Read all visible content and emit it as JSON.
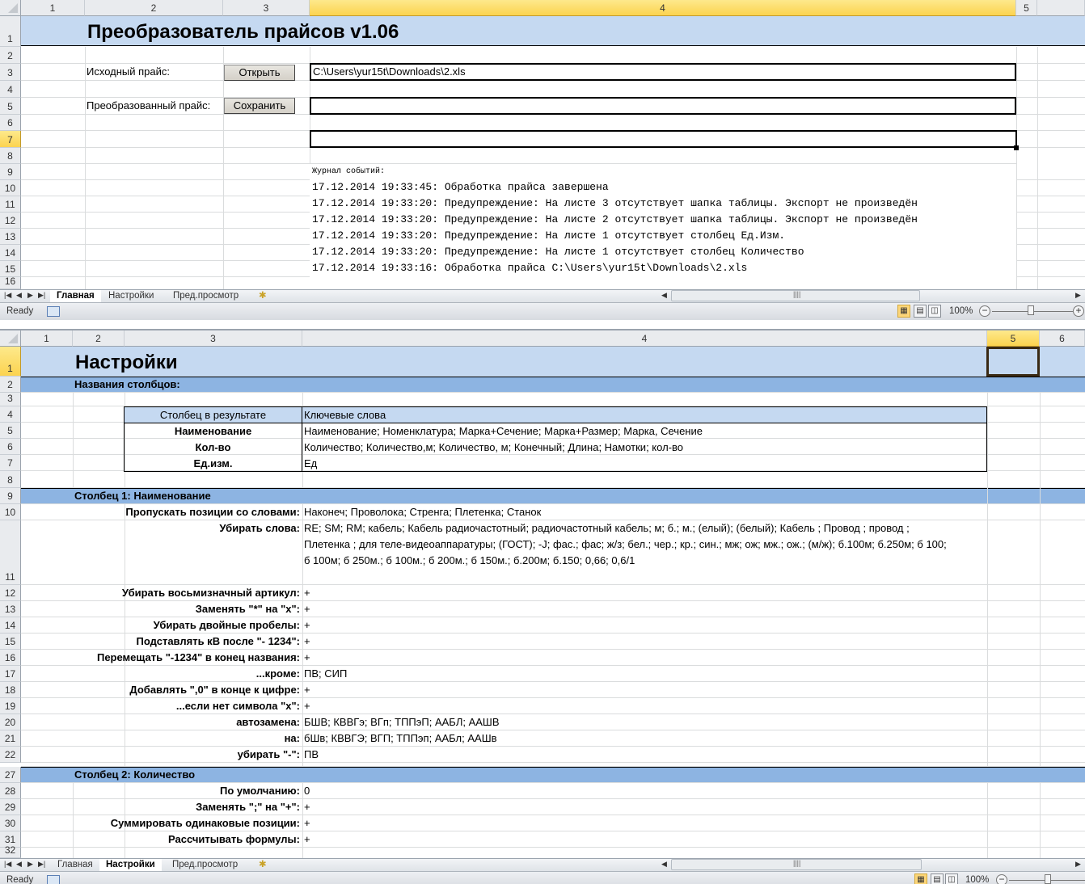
{
  "window1": {
    "col_headers": [
      "1",
      "2",
      "3",
      "4",
      "5"
    ],
    "row_headers": [
      "1",
      "2",
      "3",
      "4",
      "5",
      "6",
      "7",
      "8",
      "9",
      "10",
      "11",
      "12",
      "13",
      "14",
      "15",
      "16"
    ],
    "title": "Преобразователь прайсов v1.06",
    "source_label": "Исходный прайс:",
    "open_button": "Открыть",
    "source_path": "C:\\Users\\yur15t\\Downloads\\2.xls",
    "converted_label": "Преобразованный прайс:",
    "save_button": "Сохранить",
    "output_path": "",
    "extra_field": "",
    "log_title": "Журнал событий:",
    "log": [
      "17.12.2014 19:33:45: Обработка прайса завершена",
      "17.12.2014 19:33:20: Предупреждение: На листе  3 отсутствует шапка таблицы. Экспорт не произведён",
      "17.12.2014 19:33:20: Предупреждение: На листе  2 отсутствует шапка таблицы. Экспорт не произведён",
      "17.12.2014 19:33:20: Предупреждение: На листе  1 отсутствует столбец Ед.Изм.",
      "17.12.2014 19:33:20: Предупреждение: На листе  1 отсутствует столбец Количество",
      "17.12.2014 19:33:16: Обработка прайса C:\\Users\\yur15t\\Downloads\\2.xls"
    ],
    "tabs": [
      "Главная",
      "Настройки",
      "Пред.просмотр"
    ],
    "active_tab": "Главная",
    "status": "Ready",
    "zoom": "100%"
  },
  "window2": {
    "col_headers": [
      "1",
      "2",
      "3",
      "4",
      "5",
      "6"
    ],
    "title": "Настройки",
    "section_columns": "Названия столбцов:",
    "table_header": [
      "Столбец в результате",
      "Ключевые слова"
    ],
    "table_rows": [
      {
        "name": "Наименование",
        "keywords": "Наименование; Номенклатура; Марка+Сечение; Марка+Размер; Марка, Сечение"
      },
      {
        "name": "Кол-во",
        "keywords": "Количество; Количество,м; Количество, м; Конечный; Длина; Намотки; кол-во"
      },
      {
        "name": "Ед.изм.",
        "keywords": "Ед"
      }
    ],
    "section1": "Столбец 1: Наименование",
    "skip_label": "Пропускать позиции со словами:",
    "skip_value": "Наконеч; Проволока; Стренга; Плетенка; Станок",
    "remove_label": "Убирать слова:",
    "remove_lines": [
      "RE; SM; RM;  кабель; Кабель радиочастотный; радиочастотный кабель; м; б.; м.; (елый);  (белый); Кабель ; Провод ; провод ;",
      "Плетенка ;  для теле-видеоаппаратуры;  (ГОСТ); -J;  фас.;  фас; ж/з; бел.; чер.; кр.; син.; мж; ож; мж.; ож.; (м/ж); б.100м; б.250м; б 100;",
      "б 100м; б 250м.; б 100м.; б 200м.; б 150м.; б.200м; б.150; 0,66; 0,6/1"
    ],
    "options1": [
      {
        "row": "12",
        "label": "Убирать восьмизначный артикул:",
        "value": "+"
      },
      {
        "row": "13",
        "label": "Заменять \"*\" на \"х\":",
        "value": "+"
      },
      {
        "row": "14",
        "label": "Убирать двойные пробелы:",
        "value": "+"
      },
      {
        "row": "15",
        "label": "Подставлять кВ после \"- 1234\":",
        "value": "+"
      },
      {
        "row": "16",
        "label": "Перемещать \"-1234\" в конец названия:",
        "value": "+"
      },
      {
        "row": "17",
        "label": "...кроме:",
        "value": "ПВ; СИП"
      },
      {
        "row": "18",
        "label": "Добавлять \",0\" в конце к цифре:",
        "value": "+"
      },
      {
        "row": "19",
        "label": "...если нет символа \"х\":",
        "value": "+"
      },
      {
        "row": "20",
        "label": "автозамена:",
        "value": "БШВ; КВВГэ; ВГп; ТППэП; ААБЛ; ААШВ"
      },
      {
        "row": "21",
        "label": "на:",
        "value": "бШв; КВВГЭ; ВГП; ТППэп; ААБл; ААШв"
      },
      {
        "row": "22",
        "label": "убирать \"-\":",
        "value": "ПВ"
      }
    ],
    "section2": "Столбец 2: Количество",
    "options2": [
      {
        "row": "28",
        "label": "По умолчанию:",
        "value": "0"
      },
      {
        "row": "29",
        "label": "Заменять \";\" на \"+\":",
        "value": "+"
      },
      {
        "row": "30",
        "label": "Суммировать одинаковые позиции:",
        "value": "+"
      },
      {
        "row": "31",
        "label": "Рассчитывать формулы:",
        "value": "+"
      }
    ],
    "tabs": [
      "Главная",
      "Настройки",
      "Пред.просмотр"
    ],
    "active_tab": "Настройки",
    "status": "Ready",
    "zoom": "100%"
  },
  "colors": {
    "title_band": "#c5d9f1",
    "section_band": "#8db4e2",
    "header_sel": "#fcd34f"
  }
}
